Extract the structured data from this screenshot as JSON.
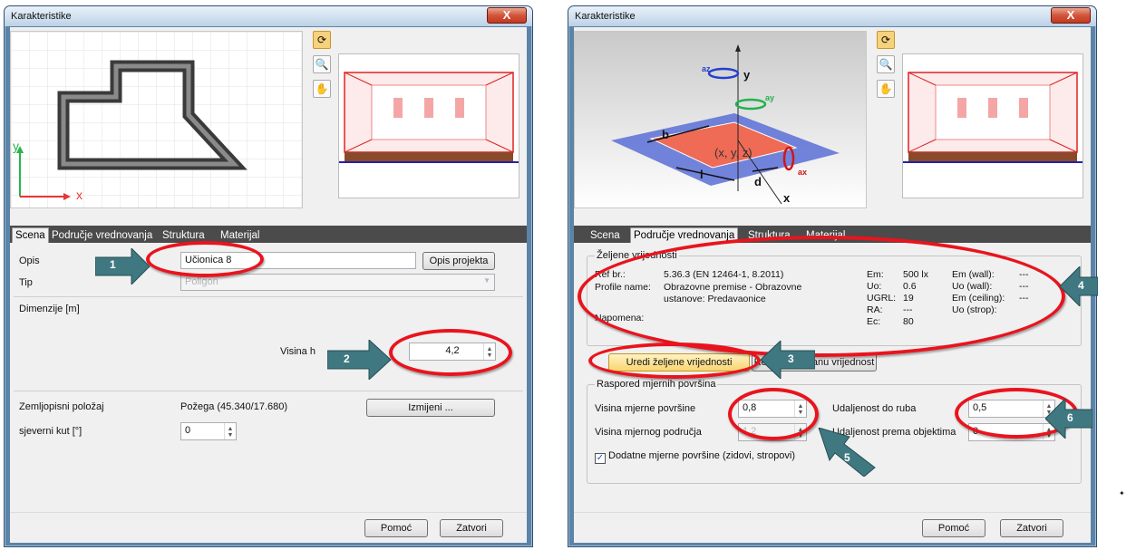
{
  "left": {
    "title": "Karakteristike",
    "close": "X",
    "tabs": [
      "Scena",
      "Područje vrednovanja",
      "Struktura",
      "Materijal"
    ],
    "opis_label": "Opis",
    "opis_value": "Učionica 8",
    "opis_projekta": "Opis projekta",
    "tip_label": "Tip",
    "tip_value": "Poligon",
    "dim_label": "Dimenzije [m]",
    "visina_label": "Visina h",
    "visina_value": "4,2",
    "geo_label": "Zemljopisni položaj",
    "geo_value": "Požega (45.340/17.680)",
    "izmijeni": "Izmijeni ...",
    "kut_label": "sjeverni kut [°]",
    "kut_value": "0",
    "axis_y": "y",
    "axis_x": "x",
    "help": "Pomoć",
    "close_btn": "Zatvori",
    "callouts": [
      "1",
      "2"
    ]
  },
  "right": {
    "title": "Karakteristike",
    "close": "X",
    "tabs": [
      "Scena",
      "Područje vrednovanja",
      "Struktura",
      "Materijal"
    ],
    "group1": "Željene vrijednosti",
    "ref_label": "Ref br.:",
    "ref_value": "5.36.3 (EN 12464-1, 8.2011)",
    "profile_label": "Profile name:",
    "profile_value1": "Obrazovne premise - Obrazovne",
    "profile_value2": "ustanove: Predavaonice",
    "napomena": "Napomena:",
    "em_l": "Em:",
    "em_v": "500 lx",
    "uo_l": "Uo:",
    "uo_v": "0.6",
    "ugrl_l": "UGRL:",
    "ugrl_v": "19",
    "ra_l": "RA:",
    "ra_v": "---",
    "ec_l": "Ec:",
    "ec_v": "80",
    "emw_l": "Em (wall):",
    "emw_v": "---",
    "uow_l": "Uo (wall):",
    "uow_v": "---",
    "emc_l": "Em (ceiling):",
    "emc_v": "---",
    "uos_l": "Uo (strop):",
    "uredi": "Uredi željene vrijednosti",
    "resetiraj": "Resetiraj zadanu vrijednost",
    "group2": "Raspored mjernih površina",
    "vmp_label": "Visina mjerne površine",
    "vmp_value": "0,8",
    "vmpod_label": "Visina mjernog područja",
    "vmpod_value": "1,2",
    "udr_label": "Udaljenost do ruba",
    "udr_value": "0,5",
    "udo_label": "Udaljenost prema objektima",
    "udo_value": "0",
    "dodatne": "Dodatne mjerne površine (zidovi, stropovi)",
    "diag_b": "b",
    "diag_l": "l",
    "diag_d": "d",
    "diag_xyz": "(x, y, z)",
    "diag_az": "az",
    "diag_ay": "ay",
    "diag_ax": "ax",
    "diag_y": "y",
    "diag_x": "x",
    "help": "Pomoć",
    "close_btn": "Zatvori",
    "callouts": [
      "3",
      "4",
      "5",
      "6"
    ]
  },
  "colors": {
    "callout": "#3f7880",
    "ring": "#e8141d",
    "tab_strip": "#4b4b4b",
    "highlight": "#f9d570"
  },
  "icons": [
    "refresh-icon",
    "zoom-icon",
    "hand-pan-icon"
  ]
}
